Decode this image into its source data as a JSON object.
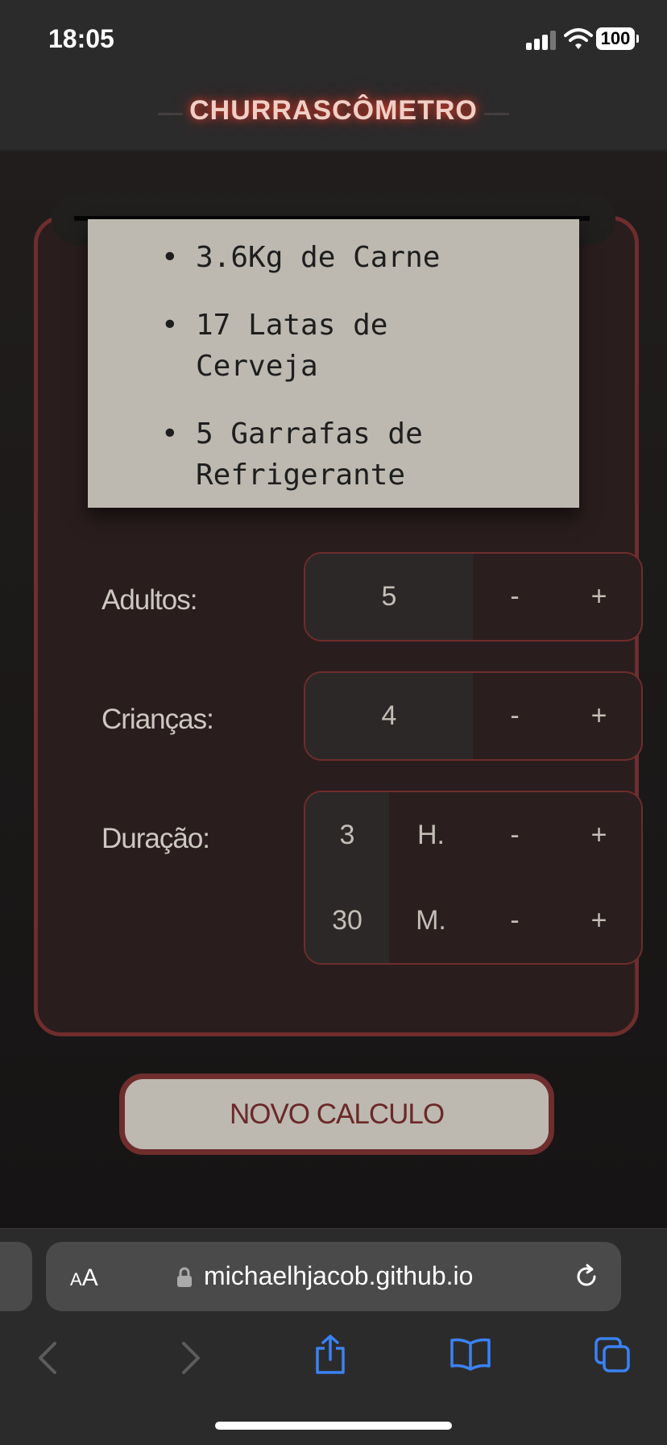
{
  "status": {
    "time": "18:05",
    "battery": "100"
  },
  "header": {
    "title": "CHURRASCÔMETRO"
  },
  "results": [
    "3.6Kg de Carne",
    "17 Latas de Cerveja",
    "5 Garrafas de Refrigerante"
  ],
  "form": {
    "adultos": {
      "label": "Adultos:",
      "value": "5",
      "minus": "-",
      "plus": "+"
    },
    "criancas": {
      "label": "Crianças:",
      "value": "4",
      "minus": "-",
      "plus": "+"
    },
    "duracao": {
      "label": "Duração:",
      "hours": {
        "value": "3",
        "unit": "H.",
        "minus": "-",
        "plus": "+"
      },
      "minutes": {
        "value": "30",
        "unit": "M.",
        "minus": "-",
        "plus": "+"
      }
    }
  },
  "action": {
    "novo_label": "NOVO CALCULO"
  },
  "browser": {
    "aa": "AA",
    "url": "michaelhjacob.github.io"
  },
  "icons": [
    "signal-icon",
    "wifi-icon",
    "battery-icon",
    "lock-icon",
    "reload-icon",
    "back-icon",
    "forward-icon",
    "share-icon",
    "bookmarks-icon",
    "tabs-icon"
  ]
}
